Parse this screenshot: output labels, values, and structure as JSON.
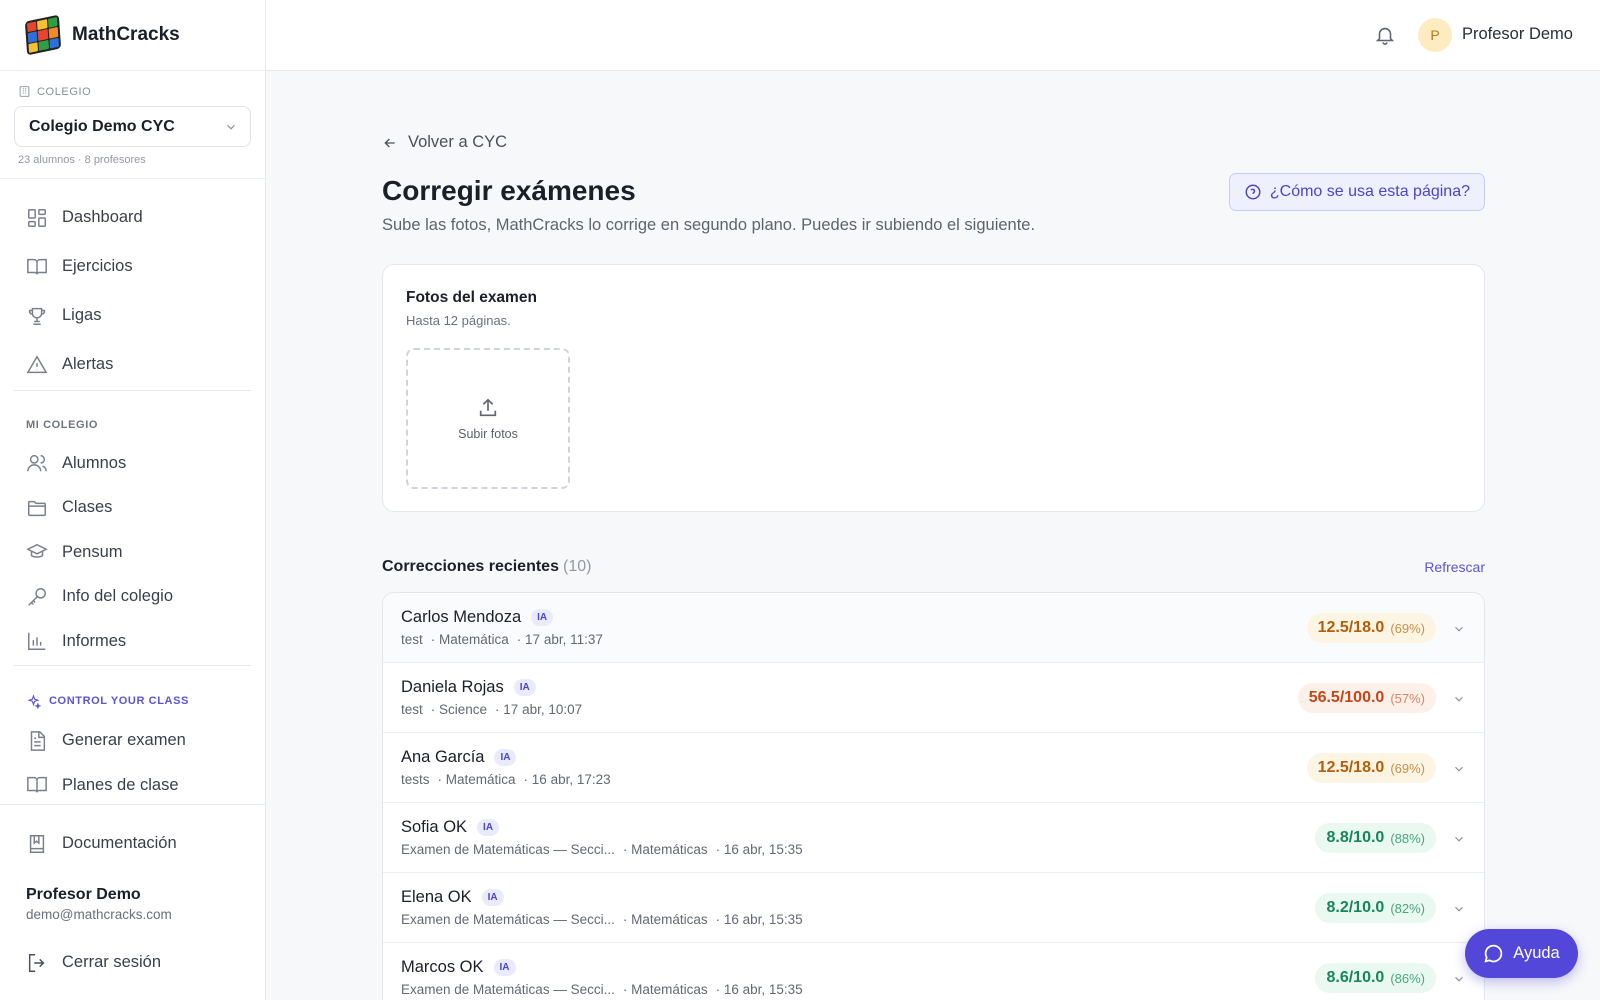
{
  "brand": {
    "name": "MathCracks"
  },
  "school": {
    "label": "COLEGIO",
    "selected": "Colegio Demo CYC",
    "meta": "23 alumnos · 8 profesores"
  },
  "nav": {
    "dashboard": "Dashboard",
    "ejercicios": "Ejercicios",
    "ligas": "Ligas",
    "alertas": "Alertas",
    "mi_colegio_heading": "MI COLEGIO",
    "alumnos": "Alumnos",
    "clases": "Clases",
    "pensum": "Pensum",
    "info": "Info del colegio",
    "informes": "Informes",
    "control_heading": "CONTROL YOUR CLASS",
    "generar": "Generar examen",
    "planes": "Planes de clase",
    "documentacion": "Documentación",
    "logout": "Cerrar sesión"
  },
  "user": {
    "name": "Profesor Demo",
    "email": "demo@mathcracks.com",
    "initial": "P"
  },
  "page": {
    "back": "Volver a CYC",
    "title": "Corregir exámenes",
    "subtitle": "Sube las fotos, MathCracks lo corrige en segundo plano. Puedes ir subiendo el siguiente.",
    "help": "¿Cómo se usa esta página?"
  },
  "upload": {
    "title": "Fotos del examen",
    "subtitle": "Hasta 12 páginas.",
    "button": "Subir fotos"
  },
  "recent": {
    "title": "Correcciones recientes",
    "count": "(10)",
    "refresh": "Refrescar",
    "ia_badge": "IA",
    "rows": [
      {
        "name": "Carlos Mendoza",
        "exam": "test",
        "subject": "Matemática",
        "date": "17 abr, 11:37",
        "score": "12.5/18.0",
        "pct": "(69%)"
      },
      {
        "name": "Daniela Rojas",
        "exam": "test",
        "subject": "Science",
        "date": "17 abr, 10:07",
        "score": "56.5/100.0",
        "pct": "(57%)"
      },
      {
        "name": "Ana García",
        "exam": "tests",
        "subject": "Matemática",
        "date": "16 abr, 17:23",
        "score": "12.5/18.0",
        "pct": "(69%)"
      },
      {
        "name": "Sofia OK",
        "exam": "Examen de Matemáticas — Secci...",
        "subject": "Matemáticas",
        "date": "16 abr, 15:35",
        "score": "8.8/10.0",
        "pct": "(88%)"
      },
      {
        "name": "Elena OK",
        "exam": "Examen de Matemáticas — Secci...",
        "subject": "Matemáticas",
        "date": "16 abr, 15:35",
        "score": "8.2/10.0",
        "pct": "(82%)"
      },
      {
        "name": "Marcos OK",
        "exam": "Examen de Matemáticas — Secci...",
        "subject": "Matemáticas",
        "date": "16 abr, 15:35",
        "score": "8.6/10.0",
        "pct": "(86%)"
      }
    ]
  },
  "fab": {
    "label": "Ayuda"
  },
  "colors": {
    "accent": "#5347d9",
    "warn": "#b45e0a",
    "bad": "#c0481c",
    "good": "#17865a"
  }
}
